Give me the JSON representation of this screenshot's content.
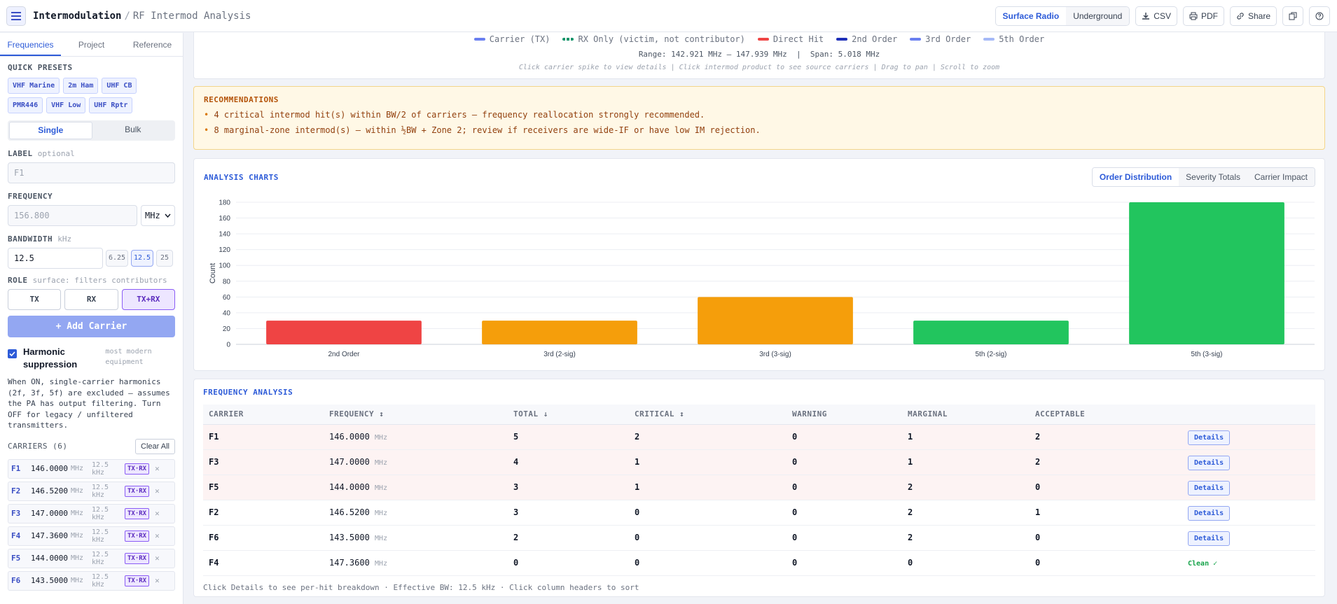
{
  "header": {
    "app_title": "Intermodulation",
    "separator": "/",
    "subtitle": "RF Intermod Analysis",
    "mode_tabs": [
      {
        "label": "Surface Radio",
        "active": true
      },
      {
        "label": "Underground",
        "active": false
      }
    ],
    "csv_label": "CSV",
    "pdf_label": "PDF",
    "share_label": "Share"
  },
  "sidebar": {
    "tabs": [
      {
        "label": "Frequencies",
        "active": true
      },
      {
        "label": "Project",
        "active": false
      },
      {
        "label": "Reference",
        "active": false
      }
    ],
    "presets_label": "QUICK PRESETS",
    "presets": [
      "VHF Marine",
      "2m Ham",
      "UHF CB",
      "PMR446",
      "VHF Low",
      "UHF Rptr"
    ],
    "entry_modes": [
      {
        "label": "Single",
        "active": true
      },
      {
        "label": "Bulk",
        "active": false
      }
    ],
    "label_field": {
      "label": "LABEL",
      "hint": "optional",
      "placeholder": "F1"
    },
    "frequency_field": {
      "label": "FREQUENCY",
      "placeholder": "156.800",
      "unit": "MHz"
    },
    "bandwidth_field": {
      "label": "BANDWIDTH",
      "unit": "kHz",
      "value": "12.5",
      "options": [
        {
          "label": "6.25",
          "active": false
        },
        {
          "label": "12.5",
          "active": true
        },
        {
          "label": "25",
          "active": false
        }
      ]
    },
    "role": {
      "label": "ROLE",
      "hint": "surface: filters contributors",
      "options": [
        {
          "label": "TX",
          "active": false
        },
        {
          "label": "RX",
          "active": false
        },
        {
          "label": "TX+RX",
          "active": true
        }
      ]
    },
    "add_button": "+ Add Carrier",
    "harmonic": {
      "label": "Harmonic suppression",
      "hint": "most modern equipment",
      "checked": true,
      "description": "When ON, single-carrier harmonics (2f, 3f, 5f) are excluded — assumes the PA has output filtering. Turn OFF for legacy / unfiltered transmitters."
    },
    "carriers_label": "CARRIERS (6)",
    "clear_all": "Clear All",
    "carriers": [
      {
        "id": "F1",
        "freq": "146.0000",
        "unit": "MHz",
        "bw": "12.5 kHz",
        "role": "TX·RX"
      },
      {
        "id": "F2",
        "freq": "146.5200",
        "unit": "MHz",
        "bw": "12.5 kHz",
        "role": "TX·RX"
      },
      {
        "id": "F3",
        "freq": "147.0000",
        "unit": "MHz",
        "bw": "12.5 kHz",
        "role": "TX·RX"
      },
      {
        "id": "F4",
        "freq": "147.3600",
        "unit": "MHz",
        "bw": "12.5 kHz",
        "role": "TX·RX"
      },
      {
        "id": "F5",
        "freq": "144.0000",
        "unit": "MHz",
        "bw": "12.5 kHz",
        "role": "TX·RX"
      },
      {
        "id": "F6",
        "freq": "143.5000",
        "unit": "MHz",
        "bw": "12.5 kHz",
        "role": "TX·RX"
      }
    ]
  },
  "spectrum": {
    "legend": [
      {
        "label": "Carrier (TX)",
        "color": "#6a7ff0",
        "style": "solid"
      },
      {
        "label": "RX Only (victim, not contributor)",
        "color": "#14956b",
        "style": "dashed"
      },
      {
        "label": "Direct Hit",
        "color": "#ef4444",
        "style": "solid"
      },
      {
        "label": "2nd Order",
        "color": "#1e2fb8",
        "style": "solid"
      },
      {
        "label": "3rd Order",
        "color": "#6a7ff0",
        "style": "solid"
      },
      {
        "label": "5th Order",
        "color": "#a5b9f7",
        "style": "solid"
      }
    ],
    "range_text": "Range: 142.921 MHz – 147.939 MHz  |  Span: 5.018 MHz",
    "hint": "Click carrier spike to view details | Click intermod product to see source carriers | Drag to pan | Scroll to zoom"
  },
  "recommendations": {
    "title": "RECOMMENDATIONS",
    "items": [
      "4 critical intermod hit(s) within BW/2 of carriers — frequency reallocation strongly recommended.",
      "8 marginal-zone intermod(s) — within ½BW + Zone 2; review if receivers are wide-IF or have low IM rejection."
    ]
  },
  "charts": {
    "title": "ANALYSIS CHARTS",
    "tabs": [
      {
        "label": "Order Distribution",
        "active": true
      },
      {
        "label": "Severity Totals",
        "active": false
      },
      {
        "label": "Carrier Impact",
        "active": false
      }
    ]
  },
  "chart_data": {
    "type": "bar",
    "categories": [
      "2nd Order",
      "3rd (2-sig)",
      "3rd (3-sig)",
      "5th (2-sig)",
      "5th (3-sig)"
    ],
    "values": [
      30,
      30,
      60,
      30,
      180
    ],
    "colors": [
      "#ef4444",
      "#f59e0b",
      "#f59e0b",
      "#22c55e",
      "#22c55e"
    ],
    "ylabel": "Count",
    "ylim": [
      0,
      180
    ],
    "yticks": [
      0,
      20,
      40,
      60,
      80,
      100,
      120,
      140,
      160,
      180
    ],
    "grid": true
  },
  "freq_analysis": {
    "title": "FREQUENCY ANALYSIS",
    "columns": [
      "CARRIER",
      "FREQUENCY ↕",
      "TOTAL ↓",
      "CRITICAL ↕",
      "WARNING",
      "MARGINAL",
      "ACCEPTABLE",
      ""
    ],
    "rows": [
      {
        "carrier": "F1",
        "freq": "146.0000",
        "unit": "MHz",
        "total": "5",
        "critical": "2",
        "warning": "0",
        "marginal": "1",
        "acceptable": "2",
        "action": "Details",
        "hot": true
      },
      {
        "carrier": "F3",
        "freq": "147.0000",
        "unit": "MHz",
        "total": "4",
        "critical": "1",
        "warning": "0",
        "marginal": "1",
        "acceptable": "2",
        "action": "Details",
        "hot": true
      },
      {
        "carrier": "F5",
        "freq": "144.0000",
        "unit": "MHz",
        "total": "3",
        "critical": "1",
        "warning": "0",
        "marginal": "2",
        "acceptable": "0",
        "action": "Details",
        "hot": true
      },
      {
        "carrier": "F2",
        "freq": "146.5200",
        "unit": "MHz",
        "total": "3",
        "critical": "0",
        "warning": "0",
        "marginal": "2",
        "acceptable": "1",
        "action": "Details",
        "hot": false
      },
      {
        "carrier": "F6",
        "freq": "143.5000",
        "unit": "MHz",
        "total": "2",
        "critical": "0",
        "warning": "0",
        "marginal": "2",
        "acceptable": "0",
        "action": "Details",
        "hot": false
      },
      {
        "carrier": "F4",
        "freq": "147.3600",
        "unit": "MHz",
        "total": "0",
        "critical": "0",
        "warning": "0",
        "marginal": "0",
        "acceptable": "0",
        "action": "Clean ✓",
        "hot": false
      }
    ],
    "footer": "Click Details to see per-hit breakdown · Effective BW: 12.5 kHz · Click column headers to sort"
  }
}
